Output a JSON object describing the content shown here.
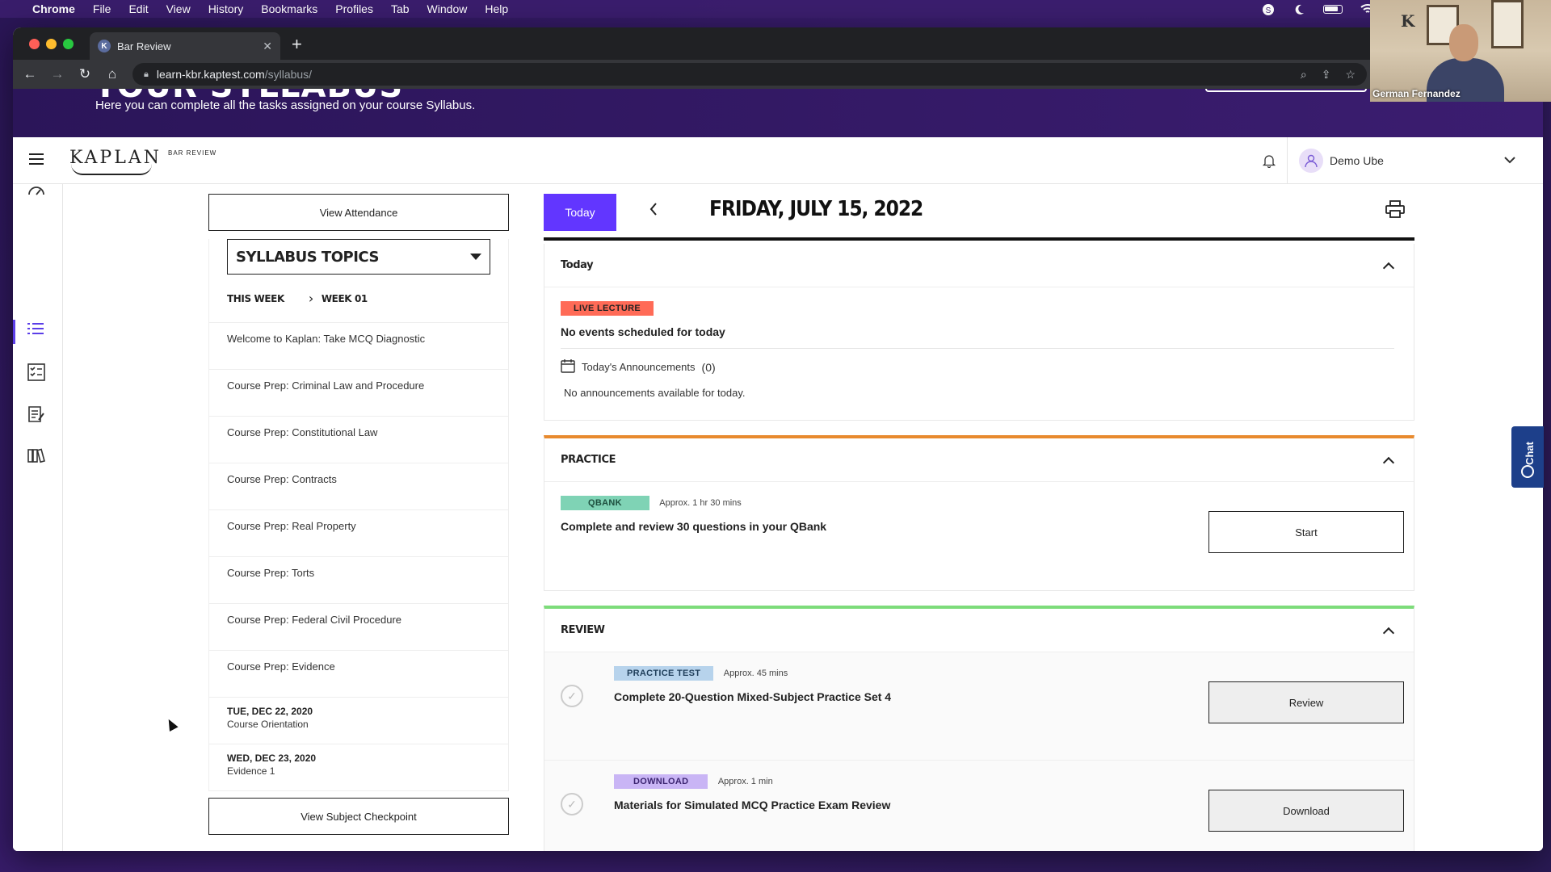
{
  "os_menubar": {
    "app": "Chrome",
    "items": [
      "File",
      "Edit",
      "View",
      "History",
      "Bookmarks",
      "Profiles",
      "Tab",
      "Window",
      "Help"
    ]
  },
  "browser": {
    "tab_title": "Bar Review",
    "tab_favicon": "K",
    "url_host": "learn-kbr.kaptest.com",
    "url_path": "/syllabus/"
  },
  "hero": {
    "heading_partial": "YOUR SYLLABUS",
    "subtitle": "Here you can complete all the tasks assigned on your course Syllabus."
  },
  "header": {
    "logo_main": "KAPLAN",
    "logo_sub": "BAR REVIEW",
    "user_name": "Demo Ube"
  },
  "sidebar": {
    "view_attendance": "View Attendance",
    "topics_select": "SYLLABUS TOPICS",
    "week_current": "THIS WEEK",
    "week_selected": "WEEK 01",
    "topics": [
      "Welcome to Kaplan: Take MCQ Diagnostic",
      "Course Prep: Criminal Law and Procedure",
      "Course Prep: Constitutional Law",
      "Course Prep: Contracts",
      "Course Prep: Real Property",
      "Course Prep: Torts",
      "Course Prep: Federal Civil Procedure",
      "Course Prep: Evidence"
    ],
    "dated_items": [
      {
        "date": "TUE, DEC 22, 2020",
        "label": "Course Orientation"
      },
      {
        "date": "WED, DEC 23, 2020",
        "label": "Evidence 1"
      }
    ],
    "view_checkpoint": "View Subject Checkpoint"
  },
  "schedule": {
    "today_button": "Today",
    "date_title": "FRIDAY, JULY 15, 2022",
    "today_section": {
      "title": "Today",
      "live_badge": "LIVE LECTURE",
      "no_events": "No events scheduled for today",
      "announcements_label": "Today's Announcements",
      "announcements_count": "(0)",
      "no_announcements": "No announcements available for today."
    },
    "practice_section": {
      "title": "PRACTICE",
      "badge": "QBANK",
      "approx": "Approx. 1 hr 30 mins",
      "item_title": "Complete and review 30 questions in your QBank",
      "action": "Start"
    },
    "review_section": {
      "title": "REVIEW",
      "items": [
        {
          "badge": "PRACTICE TEST",
          "approx": "Approx. 45 mins",
          "title": "Complete 20-Question Mixed-Subject Practice Set 4",
          "action": "Review"
        },
        {
          "badge": "DOWNLOAD",
          "approx": "Approx. 1 min",
          "title": "Materials for Simulated MCQ Practice Exam Review",
          "action": "Download"
        }
      ]
    }
  },
  "chat_tab": "Chat",
  "webcam_name": "German Fernandez",
  "colors": {
    "accent_purple": "#6236ff",
    "live_badge": "#ff6b57",
    "qbank_badge": "#7fd3b5",
    "practice_test_badge": "#b7d3ec",
    "download_badge": "#c9b5f5",
    "practice_border": "#e88a2e",
    "review_border": "#7ddc7a"
  }
}
